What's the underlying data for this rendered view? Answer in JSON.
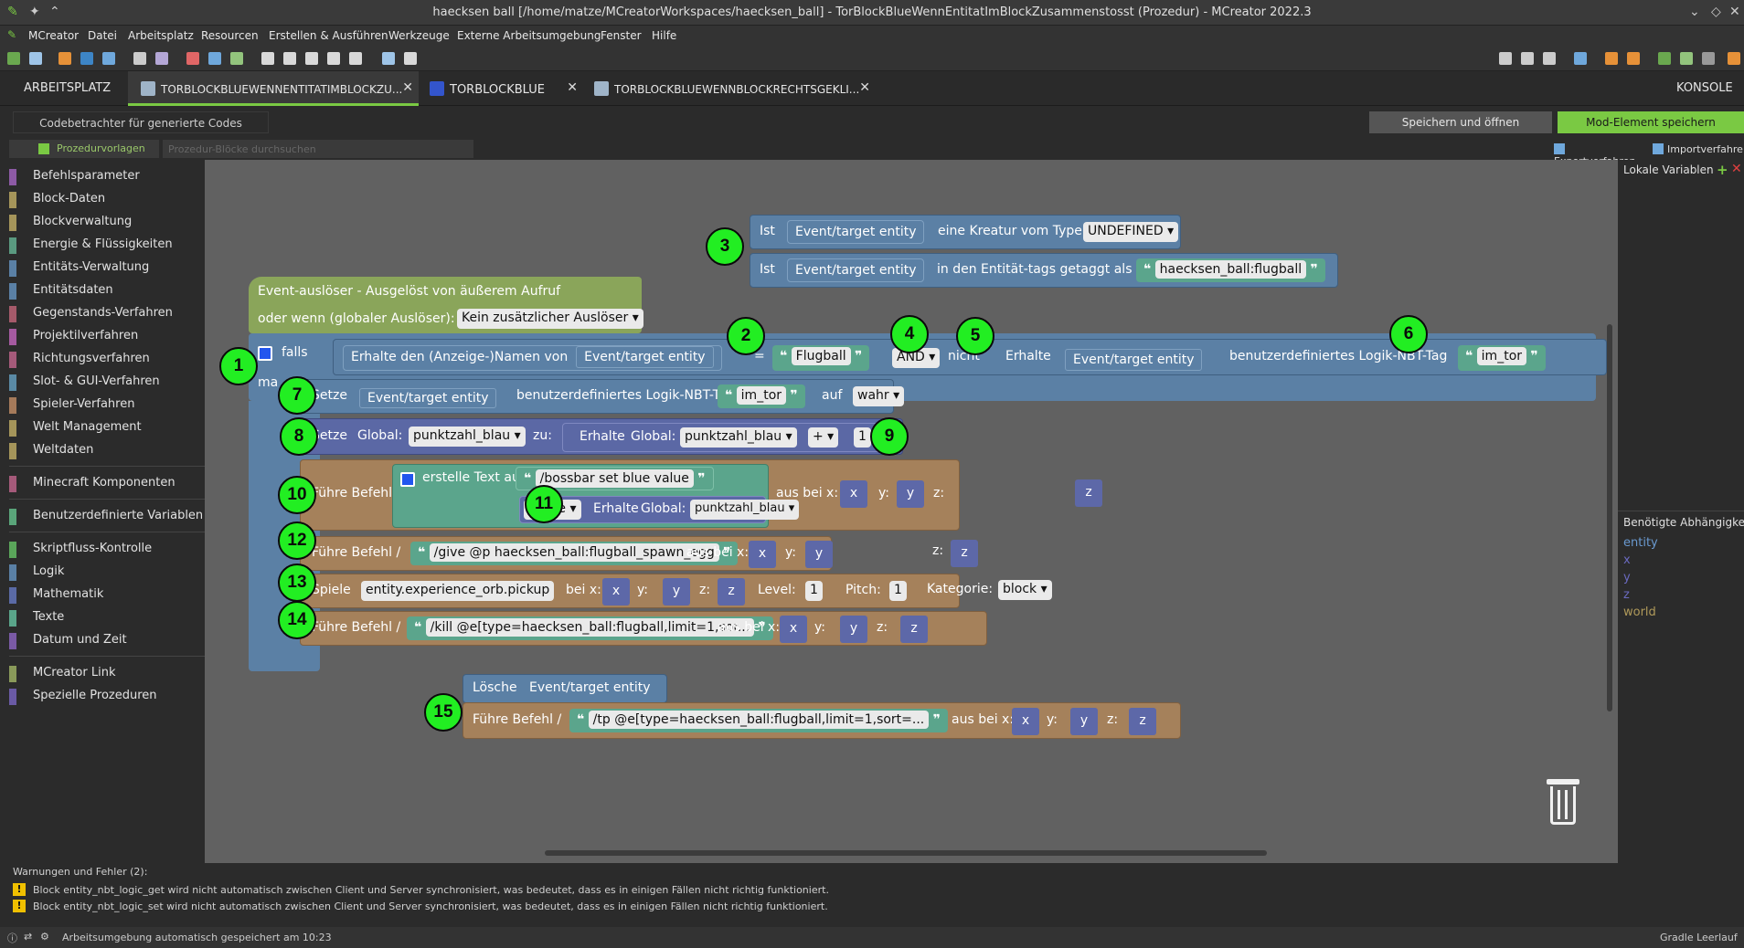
{
  "window": {
    "title": "haecksen ball [/home/matze/MCreatorWorkspaces/haecksen_ball] - TorBlockBlueWennEntitatImBlockZusammenstosst (Prozedur) - MCreator 2022.3"
  },
  "menu": [
    "MCreator",
    "Datei",
    "Arbeitsplatz",
    "Resourcen",
    "Erstellen & Ausführen",
    "Werkzeuge",
    "Externe Arbeitsumgebung",
    "Fenster",
    "Hilfe"
  ],
  "tabs": [
    {
      "label": "ARBEITSPLATZ"
    },
    {
      "label": "TORBLOCKBLUEWENNENTITATIMBLOCKZU..."
    },
    {
      "label": "TORBLOCKBLUE"
    },
    {
      "label": "TORBLOCKBLUEWENNBLOCKRECHTSGEKLI..."
    },
    {
      "label": "KONSOLE"
    }
  ],
  "subbar": {
    "code_viewer": "Codebetrachter für generierte Codes",
    "save_open": "Speichern und öffnen",
    "save_mod": "Mod-Element speichern"
  },
  "palette_tabs": {
    "templates": "Prozedurvorlagen",
    "search": "Prozedur-Blöcke durchsuchen"
  },
  "right_tabs": {
    "export": "Exportverfahren",
    "import": "Importverfahre"
  },
  "sidebar": {
    "group1": [
      {
        "label": "Befehlsparameter",
        "color": "#8d5aa5"
      },
      {
        "label": "Block-Daten",
        "color": "#a5955a"
      },
      {
        "label": "Blockverwaltung",
        "color": "#a5955a"
      },
      {
        "label": "Energie & Flüssigkeiten",
        "color": "#5a9a80"
      },
      {
        "label": "Entitäts-Verwaltung",
        "color": "#5a80a5"
      },
      {
        "label": "Entitätsdaten",
        "color": "#5a80a5"
      },
      {
        "label": "Gegenstands-Verfahren",
        "color": "#a55a6a"
      },
      {
        "label": "Projektilverfahren",
        "color": "#a55aa0"
      },
      {
        "label": "Richtungsverfahren",
        "color": "#a55a7a"
      },
      {
        "label": "Slot- & GUI-Verfahren",
        "color": "#5a8aa5"
      },
      {
        "label": "Spieler-Verfahren",
        "color": "#a57a5a"
      },
      {
        "label": "Welt Management",
        "color": "#a5955a"
      },
      {
        "label": "Weltdaten",
        "color": "#a5955a"
      }
    ],
    "group2": [
      {
        "label": "Minecraft Komponenten",
        "color": "#a55a7a"
      }
    ],
    "group3": [
      {
        "label": "Benutzerdefinierte Variablen",
        "color": "#5aa57a"
      }
    ],
    "group4": [
      {
        "label": "Skriptfluss-Kontrolle",
        "color": "#5aa55a"
      },
      {
        "label": "Logik",
        "color": "#5a80a5"
      },
      {
        "label": "Mathematik",
        "color": "#5a6aa5"
      },
      {
        "label": "Texte",
        "color": "#5aa58a"
      },
      {
        "label": "Datum und Zeit",
        "color": "#7a5aa5"
      }
    ],
    "group5": [
      {
        "label": "MCreator Link",
        "color": "#8a9a5a"
      },
      {
        "label": "Spezielle Prozeduren",
        "color": "#6a5aa5"
      }
    ]
  },
  "right_panel": {
    "local_vars": "Lokale Variablen",
    "deps_title": "Benötigte Abhängigkeit",
    "deps": [
      {
        "name": "entity",
        "color": "#6a9ad0"
      },
      {
        "name": "x",
        "color": "#6a6ac0"
      },
      {
        "name": "y",
        "color": "#6a6ac0"
      },
      {
        "name": "z",
        "color": "#6a6ac0"
      },
      {
        "name": "world",
        "color": "#b09a5a"
      }
    ]
  },
  "blocks": {
    "trigger_line1": "Event-auslöser - Ausgelöst von äußerem Aufruf",
    "trigger_line2": "oder wenn (globaler Auslöser):",
    "trigger_dd": "Kein zusätzlicher Auslöser",
    "ist": "Ist",
    "event_entity": "Event/target entity",
    "creature_type": "eine Kreatur vom Type",
    "undefined": "UNDEFINED",
    "tagged_as": "in den Entität-tags getaggt als",
    "tag_str": "haecksen_ball:flugball",
    "falls": "falls",
    "mache": "ma",
    "get_name": "Erhalte den (Anzeige-)Namen von",
    "eq": "=",
    "flugball": "Flugball",
    "and": "AND",
    "nicht": "nicht",
    "erhalte": "Erhalte",
    "logic_nbt": "benutzerdefiniertes Logik-NBT-Tag",
    "im_tor": "im_tor",
    "setze": "Setze",
    "auf": "auf",
    "wahr": "wahr",
    "global": "Global:",
    "punktzahl": "punktzahl_blau",
    "zu": "zu:",
    "plus": "+",
    "one": "1",
    "fuehre": "Führe Befehl /",
    "erstelle_text": "erstelle Text aus",
    "bossbar": "/bossbar set blue value",
    "runde": "runde",
    "aus_bei": "aus bei x:",
    "x": "x",
    "y": "y",
    "z": "z",
    "ylbl": "y:",
    "zlbl": "z:",
    "give": "/give @p haecksen_ball:flugball_spawn_egg",
    "spiele": "Spiele",
    "sound": "entity.experience_orb.pickup",
    "bei_x": "bei x:",
    "level": "Level:",
    "pitch": "Pitch:",
    "kategorie": "Kategorie:",
    "block": "block",
    "kill": "/kill @e[type=haecksen_ball:flugball,limit=1,sor...",
    "loesche": "Lösche",
    "tp": "/tp @e[type=haecksen_ball:flugball,limit=1,sort=..."
  },
  "markers": [
    "1",
    "2",
    "3",
    "4",
    "5",
    "6",
    "7",
    "8",
    "9",
    "10",
    "11",
    "12",
    "13",
    "14",
    "15"
  ],
  "console": {
    "header": "Warnungen und Fehler (2):",
    "w1": "Block entity_nbt_logic_get wird nicht automatisch zwischen Client und Server synchronisiert, was bedeutet, dass es in einigen Fällen nicht richtig funktioniert.",
    "w2": "Block entity_nbt_logic_set wird nicht automatisch zwischen Client und Server synchronisiert, was bedeutet, dass es in einigen Fällen nicht richtig funktioniert."
  },
  "status": {
    "left": "Arbeitsumgebung automatisch gespeichert am 10:23",
    "right": "Gradle Leerlauf"
  }
}
